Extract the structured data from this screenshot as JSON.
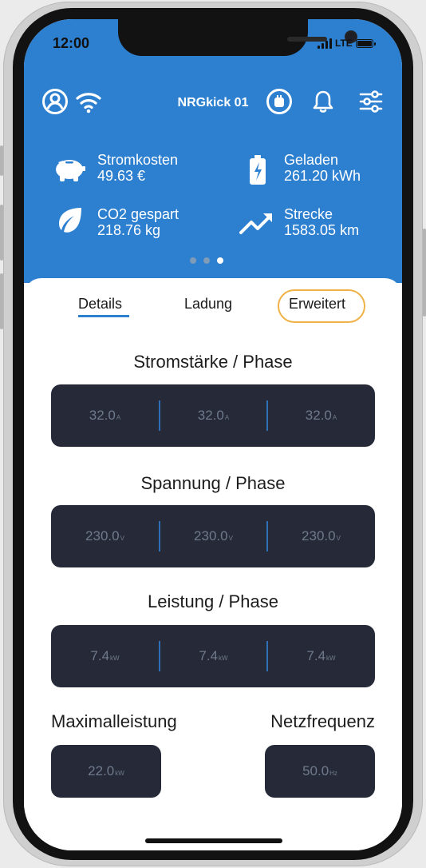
{
  "status_bar": {
    "time": "12:00",
    "network": "LTE"
  },
  "header": {
    "title": "NRGkick 01"
  },
  "stats": [
    {
      "label": "Stromkosten",
      "value": "49.63  €",
      "icon": "piggy-bank-icon"
    },
    {
      "label": "Geladen",
      "value": "261.20  kWh",
      "icon": "battery-charge-icon"
    },
    {
      "label": "CO2 gespart",
      "value": "218.76  kg",
      "icon": "leaf-icon"
    },
    {
      "label": "Strecke",
      "value": "1583.05  km",
      "icon": "trend-up-icon"
    }
  ],
  "pager": {
    "count": 3,
    "active_index": 2
  },
  "tabs": [
    {
      "label": "Details"
    },
    {
      "label": "Ladung"
    },
    {
      "label": "Erweitert"
    }
  ],
  "sections": [
    {
      "title": "Stromstärke / Phase",
      "values": [
        "32.0",
        "32.0",
        "32.0"
      ],
      "unit": "A"
    },
    {
      "title": "Spannung / Phase",
      "values": [
        "230.0",
        "230.0",
        "230.0"
      ],
      "unit": "V"
    },
    {
      "title": "Leistung / Phase",
      "values": [
        "7.4",
        "7.4",
        "7.4"
      ],
      "unit": "kW"
    }
  ],
  "max_power": {
    "label": "Maximalleistung",
    "value": "22.0",
    "unit": "kW"
  },
  "frequency": {
    "label": "Netzfrequenz",
    "value": "50.0",
    "unit": "Hz"
  },
  "colors": {
    "primary": "#2d7fd0",
    "panel": "#262a38",
    "highlight": "#f0b246"
  }
}
